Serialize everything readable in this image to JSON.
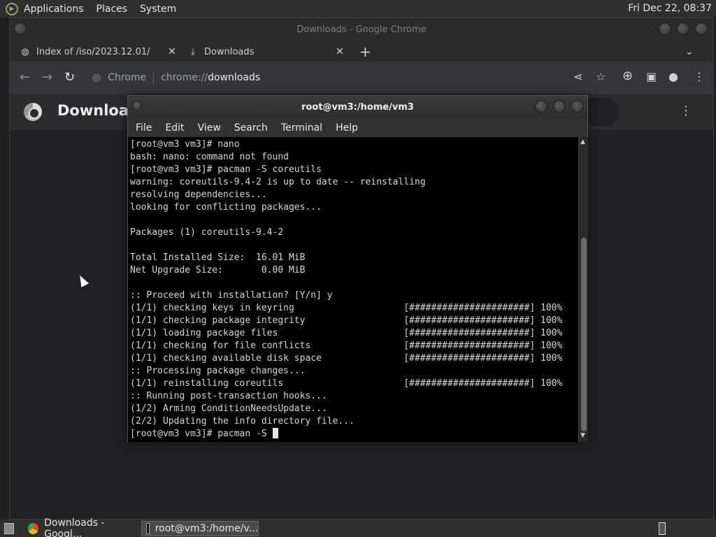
{
  "top_panel": {
    "menus": [
      "Applications",
      "Places",
      "System"
    ],
    "clock": "Fri Dec 22, 08:37"
  },
  "chrome": {
    "window_title": "Downloads - Google Chrome",
    "tabs": [
      {
        "label": "Index of /iso/2023.12.01/",
        "icon": "globe-icon"
      },
      {
        "label": "Downloads",
        "icon": "download-icon"
      }
    ],
    "omnibox": {
      "chip": "Chrome",
      "scheme": "chrome://",
      "host": "downloads"
    },
    "page_title": "Download"
  },
  "terminal": {
    "title": "root@vm3:/home/vm3",
    "menu": [
      "File",
      "Edit",
      "View",
      "Search",
      "Terminal",
      "Help"
    ],
    "lines": [
      "[root@vm3 vm3]# nano",
      "bash: nano: command not found",
      "[root@vm3 vm3]# pacman -S coreutils",
      "warning: coreutils-9.4-2 is up to date -- reinstalling",
      "resolving dependencies...",
      "looking for conflicting packages...",
      "",
      "Packages (1) coreutils-9.4-2",
      "",
      "Total Installed Size:  16.01 MiB",
      "Net Upgrade Size:       0.00 MiB",
      "",
      ":: Proceed with installation? [Y/n] y",
      "(1/1) checking keys in keyring                    [######################] 100%",
      "(1/1) checking package integrity                  [######################] 100%",
      "(1/1) loading package files                       [######################] 100%",
      "(1/1) checking for file conflicts                 [######################] 100%",
      "(1/1) checking available disk space               [######################] 100%",
      ":: Processing package changes...",
      "(1/1) reinstalling coreutils                      [######################] 100%",
      ":: Running post-transaction hooks...",
      "(1/2) Arming ConditionNeedsUpdate...",
      "(2/2) Updating the info directory file..."
    ],
    "prompt_line": "[root@vm3 vm3]# pacman -S "
  },
  "taskbar": {
    "items": [
      {
        "label": "Downloads - Googl...",
        "icon": "chrome-icon",
        "active": false
      },
      {
        "label": "root@vm3:/home/v...",
        "icon": "terminal-icon",
        "active": true
      }
    ]
  }
}
